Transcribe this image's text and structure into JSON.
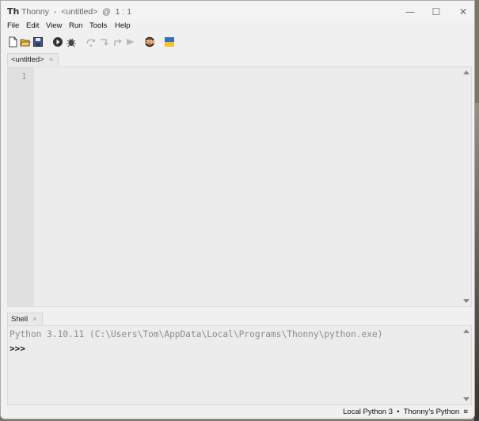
{
  "window": {
    "title": "Thonny  -  <untitled>  @  1 : 1",
    "minimize_glyph": "—",
    "maximize_glyph": "☐",
    "close_glyph": "✕"
  },
  "menu": [
    "File",
    "Edit",
    "View",
    "Run",
    "Tools",
    "Help"
  ],
  "toolbar": {
    "icons": [
      "new-file-icon",
      "open-file-icon",
      "save-icon",
      "run-icon",
      "debug-icon",
      "step-over-icon",
      "step-into-icon",
      "step-out-icon",
      "resume-icon",
      "stop-icon",
      "python-flag-icon"
    ]
  },
  "editor": {
    "tab_label": "<untitled>",
    "tab_close": "×",
    "line_numbers": [
      "1"
    ]
  },
  "shell": {
    "tab_label": "Shell",
    "tab_close": "×",
    "banner": "Python 3.10.11 (C:\\Users\\Tom\\AppData\\Local\\Programs\\Thonny\\python.exe)",
    "prompt": ">>>"
  },
  "statusbar": {
    "text": "Local Python 3  •  Thonny's Python  ≡"
  },
  "colors": {
    "stop_icon": "#b5651d",
    "run_icon": "#333333",
    "flag_blue": "#3b6fb6",
    "flag_yellow": "#f2c230"
  }
}
